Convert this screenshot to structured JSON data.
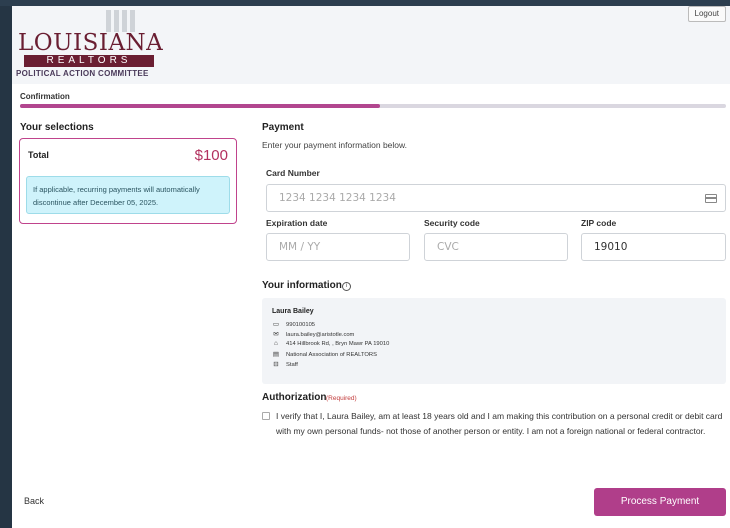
{
  "header": {
    "logo_brand": "LOUISIANA",
    "logo_sub": "REALTORS",
    "logo_pac": "POLITICAL ACTION COMMITTEE",
    "logout_label": "Logout"
  },
  "breadcrumb": {
    "label": "Confirmation"
  },
  "progress": {
    "percent": 51
  },
  "selections": {
    "title": "Your selections",
    "total_label": "Total",
    "total_value": "$100",
    "note": "If applicable, recurring payments will automatically discontinue after December 05, 2025."
  },
  "payment": {
    "title": "Payment",
    "subtitle": "Enter your payment information below.",
    "card_label": "Card Number",
    "card_placeholder": "1234 1234 1234 1234",
    "exp_label": "Expiration date",
    "exp_placeholder": "MM / YY",
    "cvc_label": "Security code",
    "cvc_placeholder": "CVC",
    "zip_label": "ZIP code",
    "zip_value": "19010"
  },
  "info": {
    "title": "Your information",
    "name": "Laura Bailey",
    "rows": [
      {
        "icon": "id-card-icon",
        "glyph": "▭",
        "text": "990100105"
      },
      {
        "icon": "envelope-icon",
        "glyph": "✉",
        "text": "laura.bailey@aristotle.com"
      },
      {
        "icon": "home-icon",
        "glyph": "⌂",
        "text": "414 Hillbrook Rd, , Bryn Mawr PA 19010"
      },
      {
        "icon": "building-icon",
        "glyph": "▤",
        "text": "National Association of REALTORS"
      },
      {
        "icon": "briefcase-icon",
        "glyph": "⊟",
        "text": "Staff"
      }
    ]
  },
  "authorization": {
    "title": "Authorization",
    "required": "(Required)",
    "text": "I verify that I, Laura Bailey, am at least 18 years old and I am making this contribution on a personal credit or debit card with my own personal funds- not those of another person or entity. I am not a foreign national or federal contractor."
  },
  "footer": {
    "back_label": "Back",
    "process_label": "Process Payment"
  },
  "colors": {
    "brand": "#6a1e32",
    "accent": "#b03e8a",
    "note_bg": "#cff3fb"
  }
}
